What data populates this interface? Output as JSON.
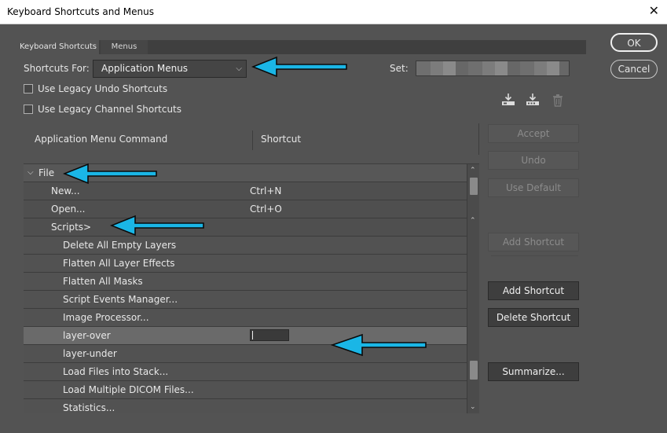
{
  "window": {
    "title": "Keyboard Shortcuts and Menus",
    "close_glyph": "✕"
  },
  "tabs": [
    {
      "label": "Keyboard Shortcuts"
    },
    {
      "label": "Menus"
    }
  ],
  "shortcuts_for": {
    "label": "Shortcuts For:",
    "value": "Application Menus",
    "chevron": "⌵"
  },
  "set": {
    "label": "Set:"
  },
  "options": {
    "legacy_undo": {
      "label": "Use Legacy Undo Shortcuts",
      "checked": false
    },
    "legacy_channel": {
      "label": "Use Legacy Channel Shortcuts",
      "checked": false
    }
  },
  "icons": [
    "save-set-icon",
    "save-as-set-icon",
    "delete-set-icon"
  ],
  "columns": {
    "command": "Application Menu Command",
    "shortcut": "Shortcut"
  },
  "rows": [
    {
      "command": "File",
      "shortcut": "",
      "level": 0,
      "caret": "⌵"
    },
    {
      "command": "New...",
      "shortcut": "Ctrl+N",
      "level": 1
    },
    {
      "command": "Open...",
      "shortcut": "Ctrl+O",
      "level": 1
    },
    {
      "command": "Scripts>",
      "shortcut": "",
      "level": 1
    },
    {
      "command": "Delete All Empty Layers",
      "shortcut": "",
      "level": 2
    },
    {
      "command": "Flatten All Layer Effects",
      "shortcut": "",
      "level": 2
    },
    {
      "command": "Flatten All Masks",
      "shortcut": "",
      "level": 2
    },
    {
      "command": "Script Events Manager...",
      "shortcut": "",
      "level": 2
    },
    {
      "command": "Image Processor...",
      "shortcut": "",
      "level": 2
    },
    {
      "command": "layer-over",
      "shortcut": "",
      "level": 2,
      "selected": true,
      "editing": true
    },
    {
      "command": "layer-under",
      "shortcut": "",
      "level": 2
    },
    {
      "command": "Load Files into Stack...",
      "shortcut": "",
      "level": 2
    },
    {
      "command": "Load Multiple DICOM Files...",
      "shortcut": "",
      "level": 2
    },
    {
      "command": "Statistics...",
      "shortcut": "",
      "level": 2
    }
  ],
  "scrollbar": {
    "up": "⌃",
    "down": "⌄"
  },
  "buttons": {
    "ok": "OK",
    "cancel": "Cancel",
    "accept": "Accept",
    "undo": "Undo",
    "use_default": "Use Default",
    "add_shortcut_disabled": "Add Shortcut",
    "add_shortcut": "Add Shortcut",
    "delete_shortcut": "Delete Shortcut",
    "summarize": "Summarize..."
  },
  "colors": {
    "arrow_fill": "#1ab6e6",
    "arrow_stroke": "#0a0a0a",
    "panel": "#535353"
  }
}
